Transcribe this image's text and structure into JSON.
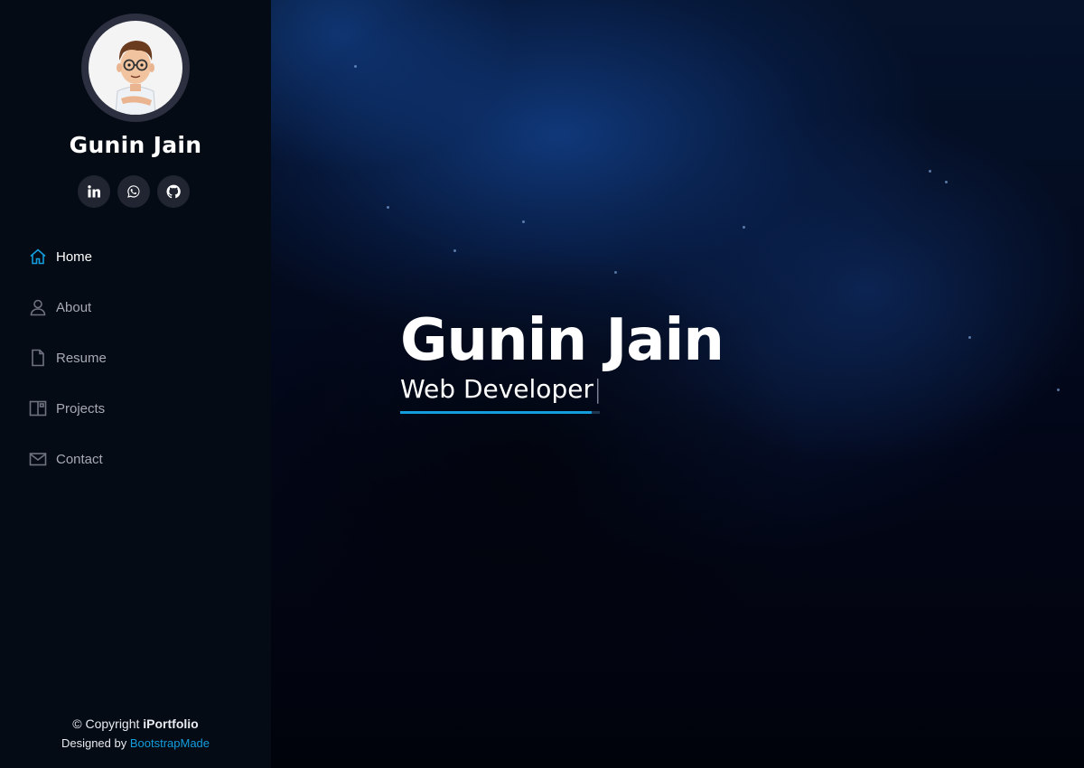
{
  "profile": {
    "name": "Gunin Jain"
  },
  "socials": [
    {
      "icon": "linkedin-icon"
    },
    {
      "icon": "whatsapp-icon"
    },
    {
      "icon": "github-icon"
    }
  ],
  "nav": {
    "items": [
      {
        "label": "Home",
        "icon": "home-icon",
        "active": true
      },
      {
        "label": "About",
        "icon": "person-icon",
        "active": false
      },
      {
        "label": "Resume",
        "icon": "file-icon",
        "active": false
      },
      {
        "label": "Projects",
        "icon": "layout-icon",
        "active": false
      },
      {
        "label": "Contact",
        "icon": "envelope-icon",
        "active": false
      }
    ]
  },
  "footer": {
    "copyright_prefix": "© Copyright ",
    "copyright_brand": "iPortfolio",
    "credits_prefix": "Designed by ",
    "credits_link": "BootstrapMade"
  },
  "hero": {
    "title": "Gunin Jain",
    "subtitle": "Web Developer",
    "cursor": "|"
  },
  "colors": {
    "accent": "#149ddd",
    "sidebar_bg": "#040b14",
    "social_bg": "#212431"
  }
}
